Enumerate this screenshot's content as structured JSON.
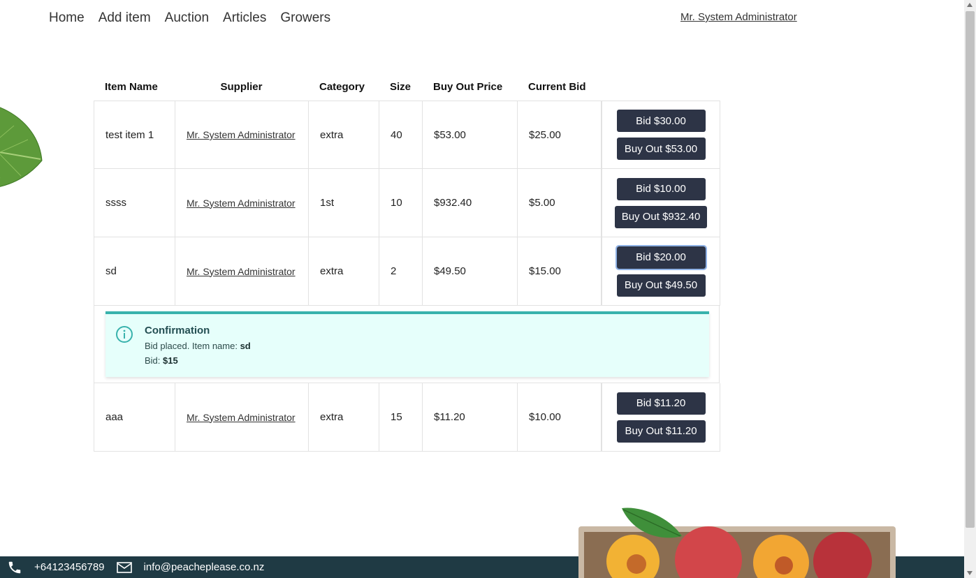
{
  "nav": {
    "home": "Home",
    "add_item": "Add item",
    "auction": "Auction",
    "articles": "Articles",
    "growers": "Growers"
  },
  "user": {
    "name": "Mr. System Administrator"
  },
  "table": {
    "headers": [
      "Item Name",
      "Supplier",
      "Category",
      "Size",
      "Buy Out Price",
      "Current Bid"
    ],
    "rows": [
      {
        "name": "test item 1",
        "supplier": "Mr. System Administrator",
        "category": "extra",
        "size": "40",
        "buyout": "$53.00",
        "bid": "$25.00",
        "bid_btn": "Bid $30.00",
        "buyout_btn": "Buy Out $53.00"
      },
      {
        "name": "ssss",
        "supplier": "Mr. System Administrator",
        "category": "1st",
        "size": "10",
        "buyout": "$932.40",
        "bid": "$5.00",
        "bid_btn": "Bid $10.00",
        "buyout_btn": "Buy Out $932.40"
      },
      {
        "name": "sd",
        "supplier": "Mr. System Administrator",
        "category": "extra",
        "size": "2",
        "buyout": "$49.50",
        "bid": "$15.00",
        "bid_btn": "Bid $20.00",
        "buyout_btn": "Buy Out $49.50"
      },
      {
        "name": "aaa",
        "supplier": "Mr. System Administrator",
        "category": "extra",
        "size": "15",
        "buyout": "$11.20",
        "bid": "$10.00",
        "bid_btn": "Bid $11.20",
        "buyout_btn": "Buy Out $11.20"
      }
    ]
  },
  "confirmation": {
    "title": "Confirmation",
    "line1_prefix": "Bid placed. Item name: ",
    "line1_value": "sd",
    "line2_prefix": "Bid: ",
    "line2_value": "$15",
    "icon": "info-circle-icon",
    "accent": "#38b2ac",
    "background": "#e6fffb"
  },
  "footer": {
    "phone": "+64123456789",
    "email": "info@peacheplease.co.nz",
    "background": "#1f3a44"
  },
  "colors": {
    "button": "#2d3446"
  }
}
